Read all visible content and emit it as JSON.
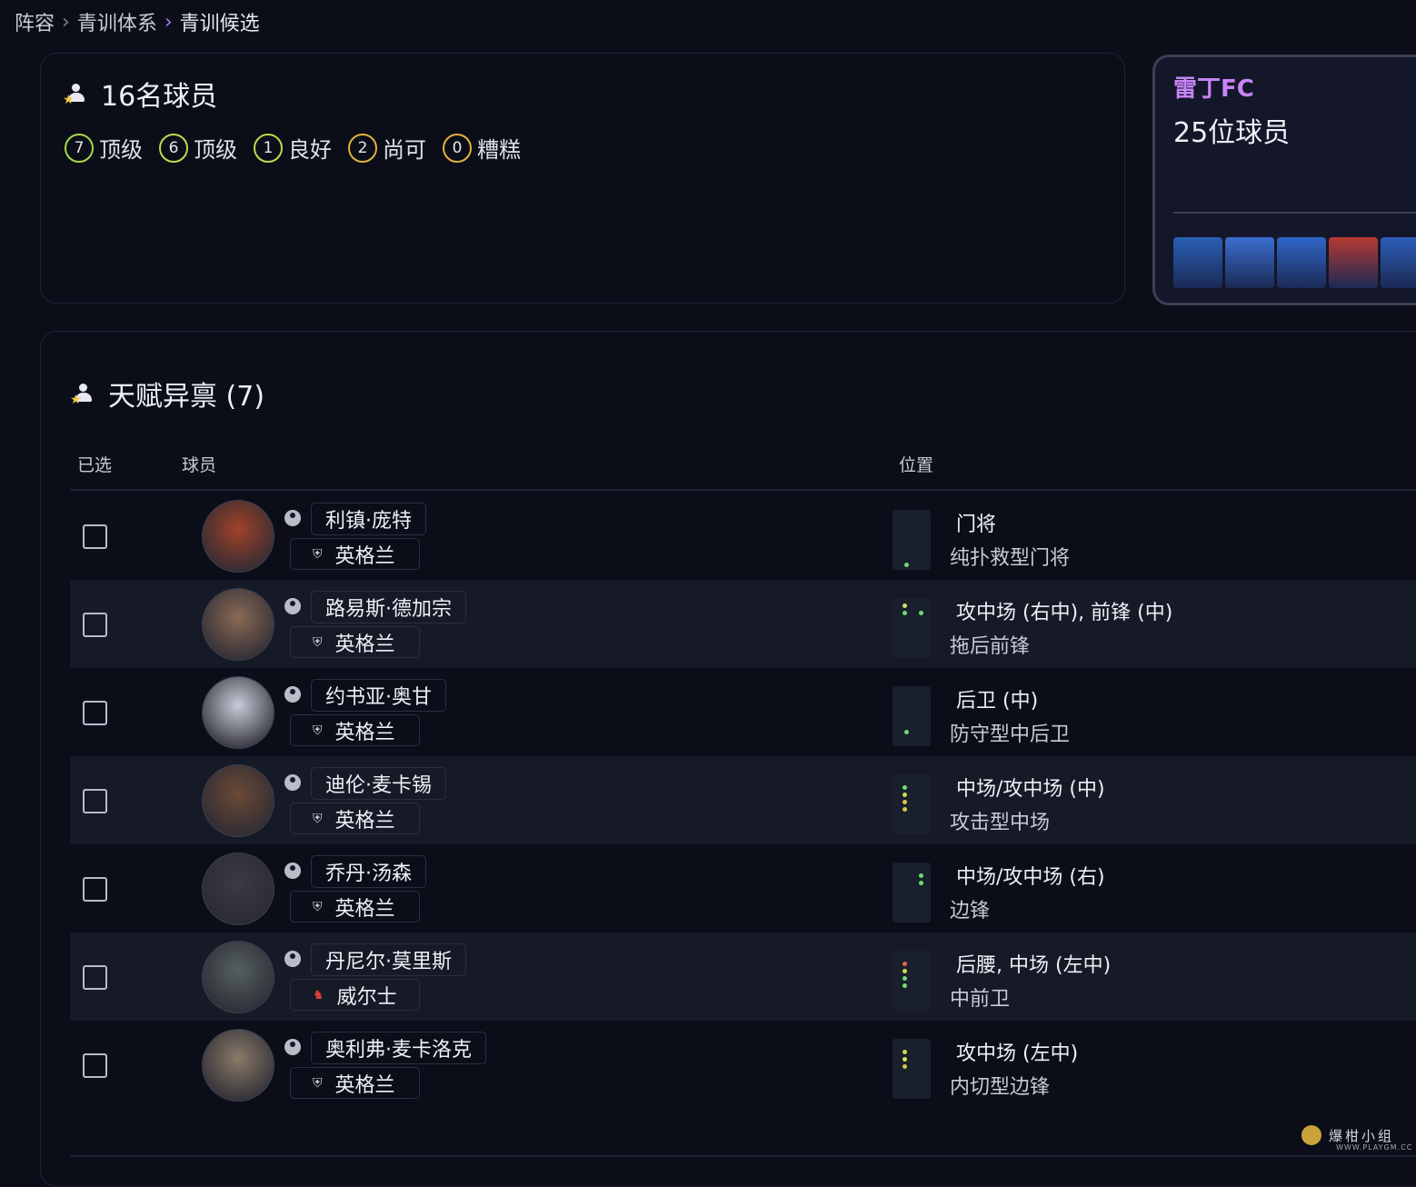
{
  "breadcrumb": [
    "阵容",
    "青训体系",
    "青训候选"
  ],
  "summary": {
    "title": "16名球员",
    "ratings": [
      {
        "count": "7",
        "label": "顶级",
        "color": "#a6d84a"
      },
      {
        "count": "6",
        "label": "顶级",
        "color": "#c6d84a"
      },
      {
        "count": "1",
        "label": "良好",
        "color": "#c6d84a"
      },
      {
        "count": "2",
        "label": "尚可",
        "color": "#e2b33a"
      },
      {
        "count": "0",
        "label": "糟糕",
        "color": "#e2b33a"
      }
    ]
  },
  "club": {
    "name": "雷丁FC",
    "players_count": "25位球员",
    "avatar_colors": [
      "#2a5fb5",
      "#3a6ecf",
      "#2f66c8",
      "#b63a33",
      "#2c5db8"
    ]
  },
  "talent_section": {
    "title": "天赋异禀 (7)",
    "columns": {
      "selected": "已选",
      "player": "球员",
      "position": "位置"
    },
    "players": [
      {
        "name": "利镇·庞特",
        "nation": "英格兰",
        "flag": "england-crest",
        "position": "门将",
        "role": "纯扑救型门将",
        "avatar_color": "#a1422a"
      },
      {
        "name": "路易斯·德加宗",
        "nation": "英格兰",
        "flag": "england-crest",
        "position": "攻中场 (右中), 前锋 (中)",
        "role": "拖后前锋",
        "avatar_color": "#8a6a55"
      },
      {
        "name": "约书亚·奥甘",
        "nation": "英格兰",
        "flag": "england-crest",
        "position": "后卫 (中)",
        "role": "防守型中后卫",
        "avatar_color": "#c8ccd8"
      },
      {
        "name": "迪伦·麦卡锡",
        "nation": "英格兰",
        "flag": "england-crest",
        "position": "中场/攻中场 (中)",
        "role": "攻击型中场",
        "avatar_color": "#6b4a36"
      },
      {
        "name": "乔丹·汤森",
        "nation": "英格兰",
        "flag": "england-crest",
        "position": "中场/攻中场 (右)",
        "role": "边锋",
        "avatar_color": "#3c3a44"
      },
      {
        "name": "丹尼尔·莫里斯",
        "nation": "威尔士",
        "flag": "wales-dragon",
        "position": "后腰, 中场 (左中)",
        "role": "中前卫",
        "avatar_color": "#556060"
      },
      {
        "name": "奥利弗·麦卡洛克",
        "nation": "英格兰",
        "flag": "england-crest",
        "position": "攻中场 (左中)",
        "role": "内切型边锋",
        "avatar_color": "#8a7a68"
      }
    ]
  },
  "watermark": {
    "text": "爆柑小组",
    "sub": "WWW.PLAYGM.CC"
  }
}
